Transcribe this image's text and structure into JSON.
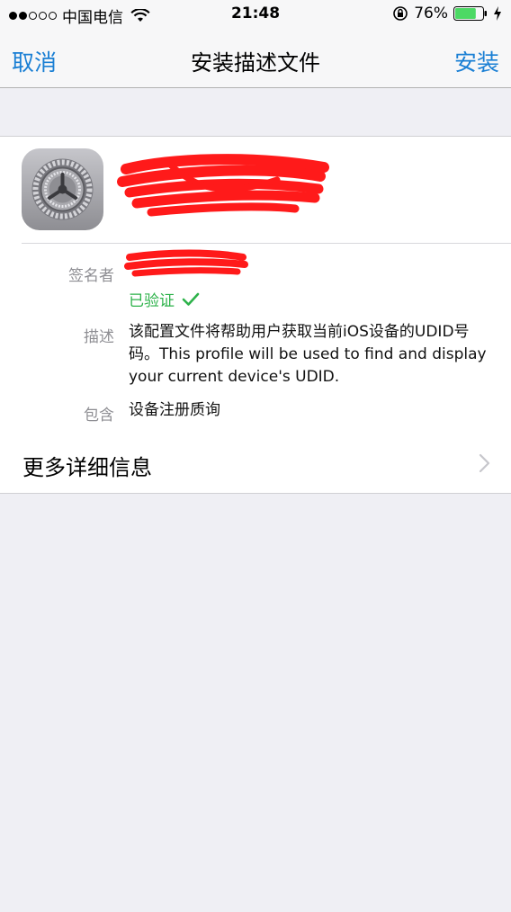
{
  "status_bar": {
    "carrier": "中国电信",
    "time": "21:48",
    "battery_percent": "76%",
    "battery_level": 0.76,
    "signal_dots_filled": 2,
    "signal_dots_total": 5
  },
  "nav": {
    "cancel_label": "取消",
    "title": "安装描述文件",
    "install_label": "安装"
  },
  "profile": {
    "icon": "settings-gear-icon",
    "signer_label": "签名者",
    "verified_label": "已验证",
    "description_label": "描述",
    "description_lines": [
      "该配置文件将帮助用户获取当前iOS设备的UDID号",
      "码。This profile will be used to find and display",
      "your current device's UDID."
    ],
    "contains_label": "包含",
    "contains_value": "设备注册质询"
  },
  "more_details": {
    "label": "更多详细信息"
  },
  "colors": {
    "accent": "#1a7fd4",
    "verified": "#2db24a",
    "redaction": "#ff1a1a"
  }
}
